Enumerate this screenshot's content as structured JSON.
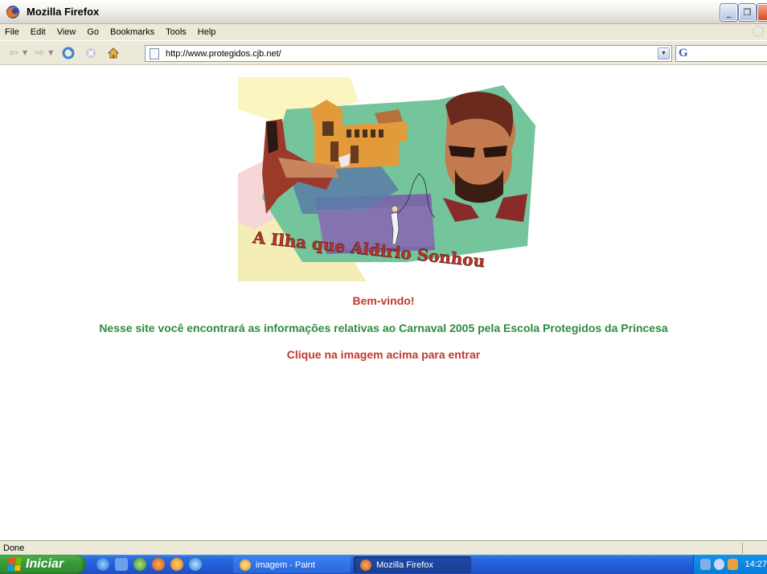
{
  "window": {
    "title": "Mozilla Firefox",
    "minimize_icon": "minimize-icon",
    "maximize_icon": "restore-icon",
    "close_icon": "close-icon"
  },
  "menu": {
    "items": [
      "File",
      "Edit",
      "View",
      "Go",
      "Bookmarks",
      "Tools",
      "Help"
    ]
  },
  "navbar": {
    "url": "http://www.protegidos.cjb.net/",
    "icons": [
      "back-icon",
      "forward-icon",
      "reload-icon",
      "stop-icon",
      "home-icon"
    ]
  },
  "page": {
    "banner_text": "A Ilha que Aldirio Sonhou",
    "welcome": "Bem-vindo!",
    "info": "Nesse site você encontrará as informações relativas ao Carnaval 2005 pela Escola Protegidos da Princesa",
    "click": "Clique na imagem acima para entrar"
  },
  "status": {
    "text": "Done"
  },
  "taskbar": {
    "start_label": "Iniciar",
    "tasks": [
      "imagem - Paint",
      "Mozilla Firefox"
    ],
    "clock": "14:27"
  },
  "colors": {
    "welcome": "#c0392b",
    "info": "#2e8b3e",
    "taskbar": "#245edb",
    "start": "#3a9a3a"
  }
}
